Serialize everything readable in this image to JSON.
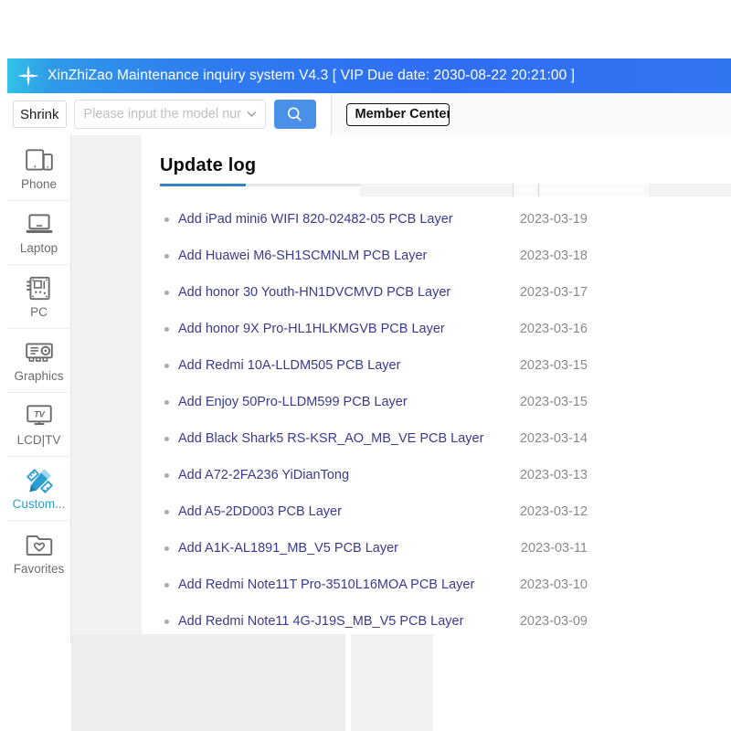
{
  "window": {
    "title": "XinZhiZao Maintenance inquiry system V4.3 [ VIP Due date: 2030-08-22 20:21:00 ]",
    "logo_icon": "compass-star-icon",
    "titlebar_color": "#2f7bf0"
  },
  "toolbar": {
    "shrink_label": "Shrink",
    "search_placeholder": "Please input the model numb",
    "search_value": "",
    "dropdown_icon": "chevron-down-icon",
    "search_icon": "search-icon",
    "search_button_color": "#4a90e8"
  },
  "tabs": {
    "items": [
      {
        "label": "Member Center",
        "active": true
      }
    ]
  },
  "sidebar": {
    "items": [
      {
        "label": "Phone",
        "icon": "phone-tablet-icon",
        "active": false
      },
      {
        "label": "Laptop",
        "icon": "laptop-icon",
        "active": false
      },
      {
        "label": "PC",
        "icon": "motherboard-icon",
        "active": false
      },
      {
        "label": "Graphics",
        "icon": "graphics-card-icon",
        "active": false
      },
      {
        "label": "LCD|TV",
        "icon": "tv-icon",
        "active": false
      },
      {
        "label": "Custom...",
        "icon": "pen-ruler-icon",
        "active": true
      },
      {
        "label": "Favorites",
        "icon": "folder-heart-icon",
        "active": false
      }
    ],
    "active_color": "#2b9fd4",
    "inactive_color": "#6b6b6b"
  },
  "content": {
    "panel_title": "Update log",
    "accent_color": "#3383c4",
    "link_color": "#3a3a8c",
    "date_color": "#8a8a8a",
    "log_entries": [
      {
        "text": "Add iPad mini6 WIFI 820-02482-05 PCB Layer",
        "date": "2023-03-19"
      },
      {
        "text": "Add Huawei M6-SH1SCMNLM PCB Layer",
        "date": "2023-03-18"
      },
      {
        "text": "Add honor 30 Youth-HN1DVCMVD PCB Layer",
        "date": "2023-03-17"
      },
      {
        "text": "Add honor 9X Pro-HL1HLKMGVB PCB Layer",
        "date": "2023-03-16"
      },
      {
        "text": "Add Redmi 10A-LLDM505 PCB Layer",
        "date": "2023-03-15"
      },
      {
        "text": "Add Enjoy 50Pro-LLDM599 PCB Layer",
        "date": "2023-03-15"
      },
      {
        "text": "Add Black Shark5 RS-KSR_AO_MB_VE PCB Layer",
        "date": "2023-03-14"
      },
      {
        "text": "Add A72-2FA236 YiDianTong",
        "date": "2023-03-13"
      },
      {
        "text": "Add A5-2DD003 PCB Layer",
        "date": "2023-03-12"
      },
      {
        "text": "Add A1K-AL1891_MB_V5 PCB Layer",
        "date": "2023-03-11"
      },
      {
        "text": "Add Redmi Note11T Pro-3510L16MOA PCB Layer",
        "date": "2023-03-10"
      },
      {
        "text": "Add Redmi Note11 4G-J19S_MB_V5 PCB Layer",
        "date": "2023-03-09"
      }
    ]
  }
}
